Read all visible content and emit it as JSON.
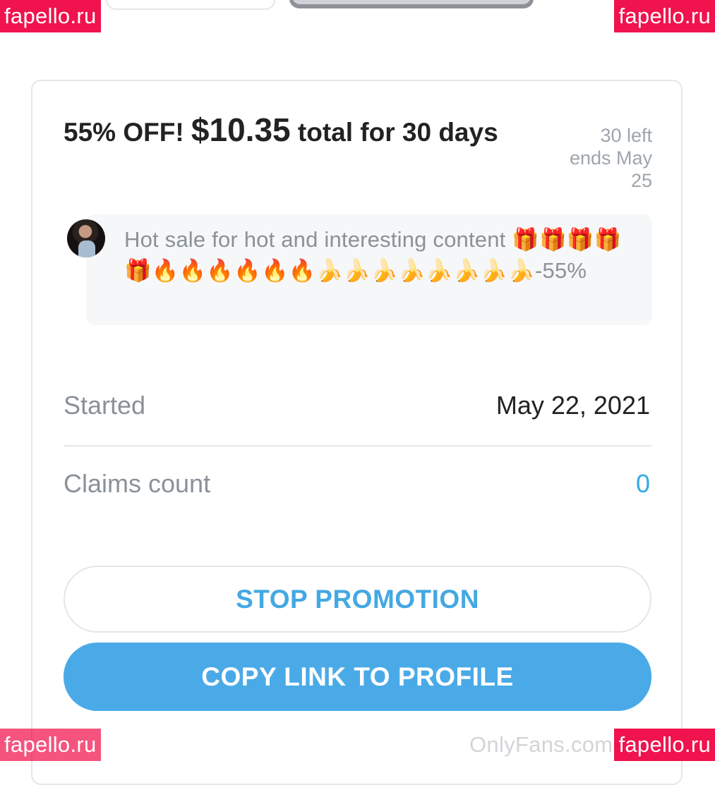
{
  "watermark": {
    "text": "fapello.ru",
    "color": "#f0134d"
  },
  "offer": {
    "title_prefix": "55% OFF! ",
    "title_price": "$10.35",
    "title_suffix": " total for 30 days",
    "left_count": "30 left",
    "ends_line1": "ends May",
    "ends_line2": "25"
  },
  "message": {
    "avatar": "profile-avatar",
    "text": "Hot sale for hot and interesting content 🎁🎁🎁🎁🎁🔥🔥🔥🔥🔥🔥🍌🍌🍌🍌🍌🍌🍌🍌-55%"
  },
  "details": {
    "started_label": "Started",
    "started_value": "May 22, 2021",
    "claims_label": "Claims count",
    "claims_value": "0"
  },
  "buttons": {
    "stop": "STOP PROMOTION",
    "copy": "COPY LINK TO PROFILE"
  },
  "footer": {
    "brand": "OnlyFans.com"
  },
  "colors": {
    "accent": "#4aaae7",
    "accent_text": "#44a8e2",
    "muted": "#8a9198"
  }
}
